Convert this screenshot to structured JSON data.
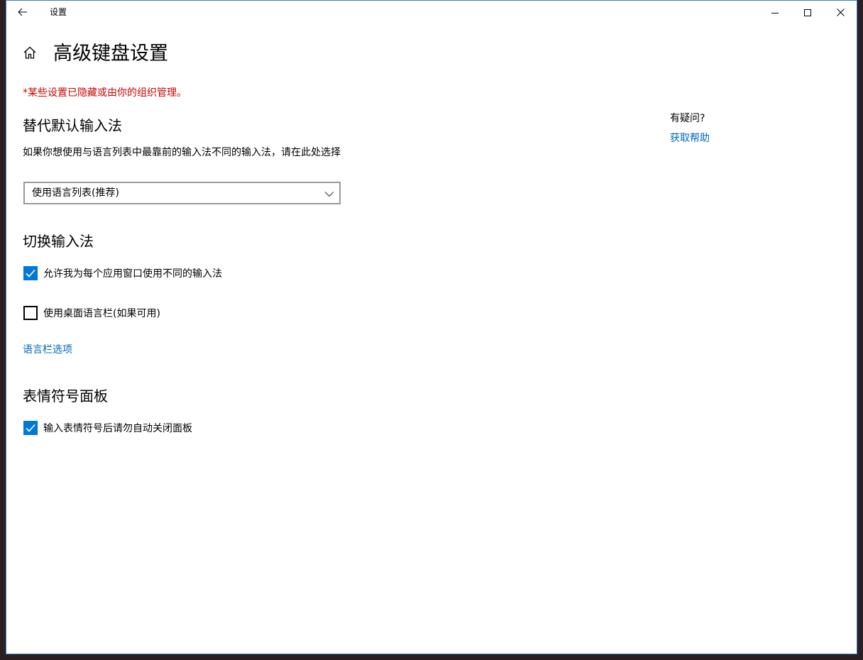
{
  "titlebar": {
    "title": "设置",
    "back_icon": "arrow-left",
    "minimize_icon": "minimize",
    "maximize_icon": "maximize",
    "close_icon": "close"
  },
  "page": {
    "home_icon": "home",
    "title": "高级键盘设置",
    "warning": "*某些设置已隐藏或由你的组织管理。"
  },
  "override_default": {
    "heading": "替代默认输入法",
    "description": "如果你想使用与语言列表中最靠前的输入法不同的输入法，请在此处选择",
    "selected_value": "使用语言列表(推荐)"
  },
  "switching": {
    "heading": "切换输入法",
    "options": [
      {
        "label": "允许我为每个应用窗口使用不同的输入法",
        "checked": true
      },
      {
        "label": "使用桌面语言栏(如果可用)",
        "checked": false
      }
    ],
    "language_bar_link": "语言栏选项"
  },
  "emoji_panel": {
    "heading": "表情符号面板",
    "options": [
      {
        "label": "输入表情符号后请勿自动关闭面板",
        "checked": true
      }
    ]
  },
  "help": {
    "question": "有疑问?",
    "link": "获取帮助"
  },
  "colors": {
    "accent": "#0078d7",
    "link": "#0067b8",
    "warning": "#c50500"
  }
}
